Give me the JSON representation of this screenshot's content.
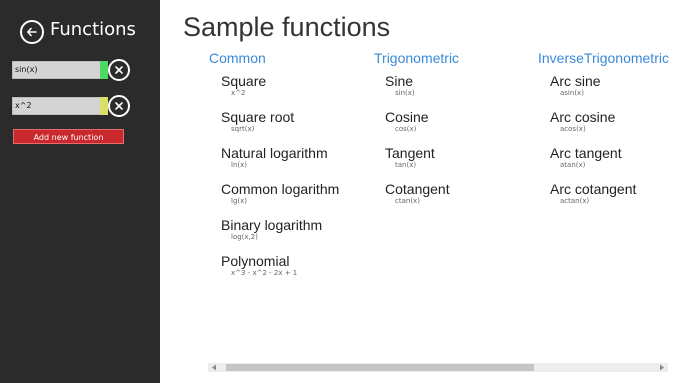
{
  "sidebar": {
    "title": "Functions",
    "functions": [
      {
        "value": "sin(x)",
        "color": "#4cd964"
      },
      {
        "value": "x^2",
        "color": "#d8e06a"
      }
    ],
    "add_button_label": "Add new function"
  },
  "main": {
    "title": "Sample functions",
    "columns": [
      {
        "header": "Common",
        "items": [
          {
            "name": "Square",
            "expr": "x^2"
          },
          {
            "name": "Square root",
            "expr": "sqrt(x)"
          },
          {
            "name": "Natural logarithm",
            "expr": "ln(x)"
          },
          {
            "name": "Common logarithm",
            "expr": "lg(x)"
          },
          {
            "name": "Binary logarithm",
            "expr": "log(x,2)"
          },
          {
            "name": "Polynomial",
            "expr": "x^3 - x^2 - 2x + 1"
          }
        ]
      },
      {
        "header": "Trigonometric",
        "items": [
          {
            "name": "Sine",
            "expr": "sin(x)"
          },
          {
            "name": "Cosine",
            "expr": "cos(x)"
          },
          {
            "name": "Tangent",
            "expr": "tan(x)"
          },
          {
            "name": "Cotangent",
            "expr": "ctan(x)"
          }
        ]
      },
      {
        "header": "InverseTrigonometric",
        "items": [
          {
            "name": "Arc sine",
            "expr": "asin(x)"
          },
          {
            "name": "Arc cosine",
            "expr": "acos(x)"
          },
          {
            "name": "Arc tangent",
            "expr": "atan(x)"
          },
          {
            "name": "Arc cotangent",
            "expr": "actan(x)"
          }
        ]
      }
    ]
  },
  "icons": {
    "back": "back-arrow-icon",
    "remove": "close-icon",
    "scroll_left": "chevron-left-icon",
    "scroll_right": "chevron-right-icon"
  }
}
